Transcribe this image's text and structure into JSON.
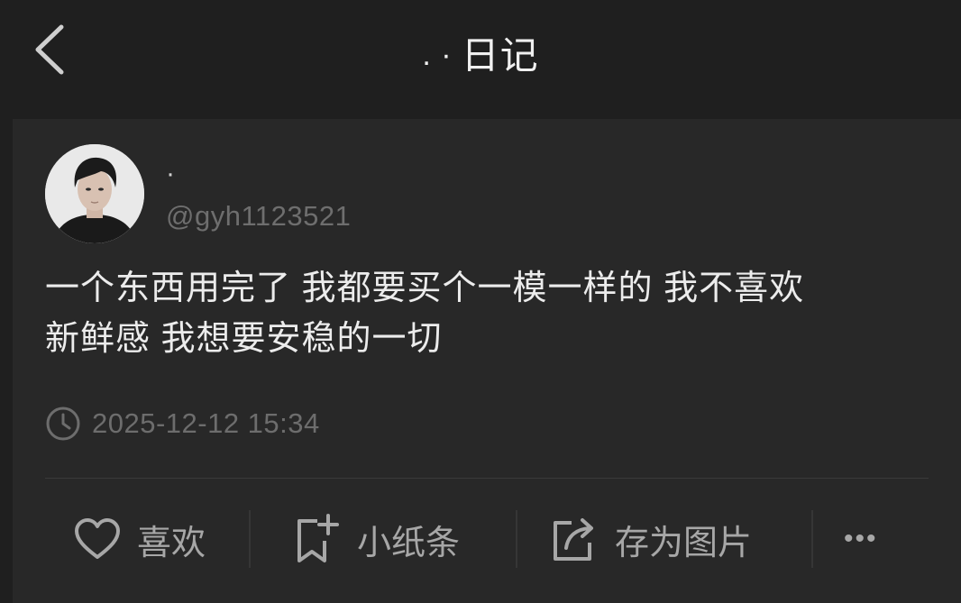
{
  "header": {
    "title_dots": ". ·",
    "title": "日记"
  },
  "post": {
    "display_name": "·",
    "handle": "@gyh1123521",
    "content_line1": "一个东西用完了 我都要买个一模一样的 我不喜欢",
    "content_line2": "新鲜感 我想要安稳的一切",
    "timestamp": "2025-12-12 15:34"
  },
  "actions": {
    "like": "喜欢",
    "note": "小纸条",
    "save_image": "存为图片",
    "more": "•••"
  },
  "icons": [
    "back-chevron-icon",
    "clock-icon",
    "heart-icon",
    "bookmark-add-icon",
    "share-export-icon",
    "more-icon"
  ],
  "colors": {
    "background": "#1f1f1f",
    "card": "#282828",
    "text": "#ececec",
    "muted": "#6d6d6d",
    "action": "#a7a7a7"
  }
}
